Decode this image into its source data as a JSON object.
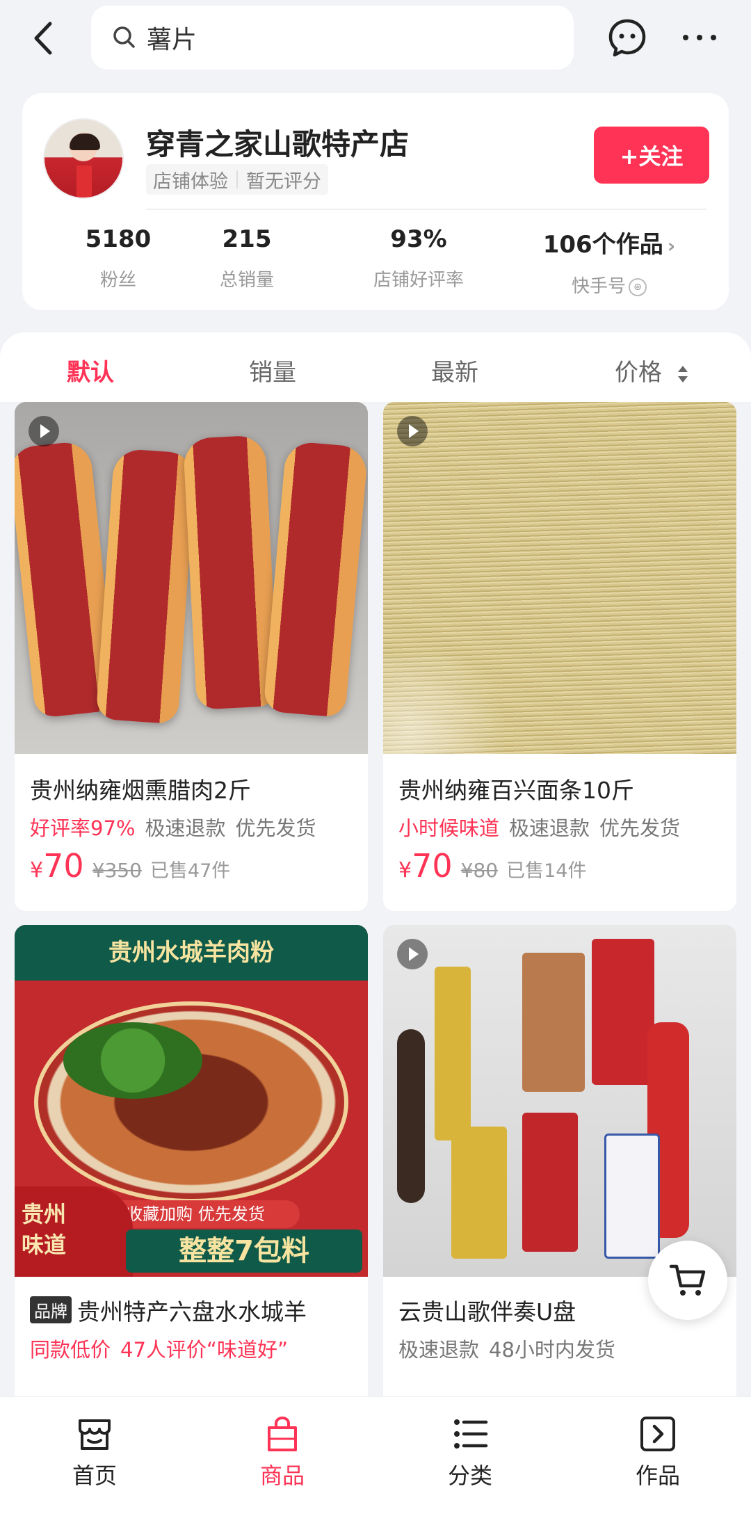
{
  "search": {
    "value": "薯片"
  },
  "shop": {
    "name": "穿青之家山歌特产店",
    "tag1": "店铺体验",
    "tag2": "暂无评分",
    "follow_label": "+关注",
    "stats": [
      {
        "value": "5180",
        "label": "粉丝"
      },
      {
        "value": "215",
        "label": "总销量"
      },
      {
        "value": "93%",
        "label": "店铺好评率"
      },
      {
        "value": "106个作品",
        "label": "快手号"
      }
    ]
  },
  "sort_tabs": [
    "默认",
    "销量",
    "最新",
    "价格"
  ],
  "products": [
    {
      "title": "贵州纳雍烟熏腊肉2斤",
      "tags": [
        {
          "text": "好评率97%",
          "highlight": true
        },
        {
          "text": "极速退款"
        },
        {
          "text": "优先发货"
        }
      ],
      "price_symbol": "¥",
      "price": "70",
      "original_price": "¥350",
      "sold": "已售47件"
    },
    {
      "title": "贵州纳雍百兴面条10斤",
      "tags": [
        {
          "text": "小时候味道",
          "highlight": true
        },
        {
          "text": "极速退款"
        },
        {
          "text": "优先发货"
        }
      ],
      "price_symbol": "¥",
      "price": "70",
      "original_price": "¥80",
      "sold": "已售14件"
    },
    {
      "badge": "品牌",
      "title": "贵州特产六盘水水城羊",
      "tags": [
        {
          "text": "同款低价",
          "highlight": true
        },
        {
          "text": "47人评价“味道好”",
          "highlight": true
        }
      ],
      "image_text": {
        "banner": "贵州水城羊肉粉",
        "flavor": "贵州\n味道",
        "promo": "收藏加购 优先发货",
        "pack": "整整7包料"
      }
    },
    {
      "title": "云贵山歌伴奏U盘",
      "tags": [
        {
          "text": "极速退款"
        },
        {
          "text": "48小时内发货"
        }
      ]
    }
  ],
  "bottom_nav": [
    {
      "label": "首页",
      "icon": "shop-icon"
    },
    {
      "label": "商品",
      "icon": "bag-icon",
      "active": true
    },
    {
      "label": "分类",
      "icon": "list-icon"
    },
    {
      "label": "作品",
      "icon": "play-box-icon"
    }
  ],
  "colors": {
    "accent": "#fe3355",
    "background": "#f2f3f7"
  }
}
